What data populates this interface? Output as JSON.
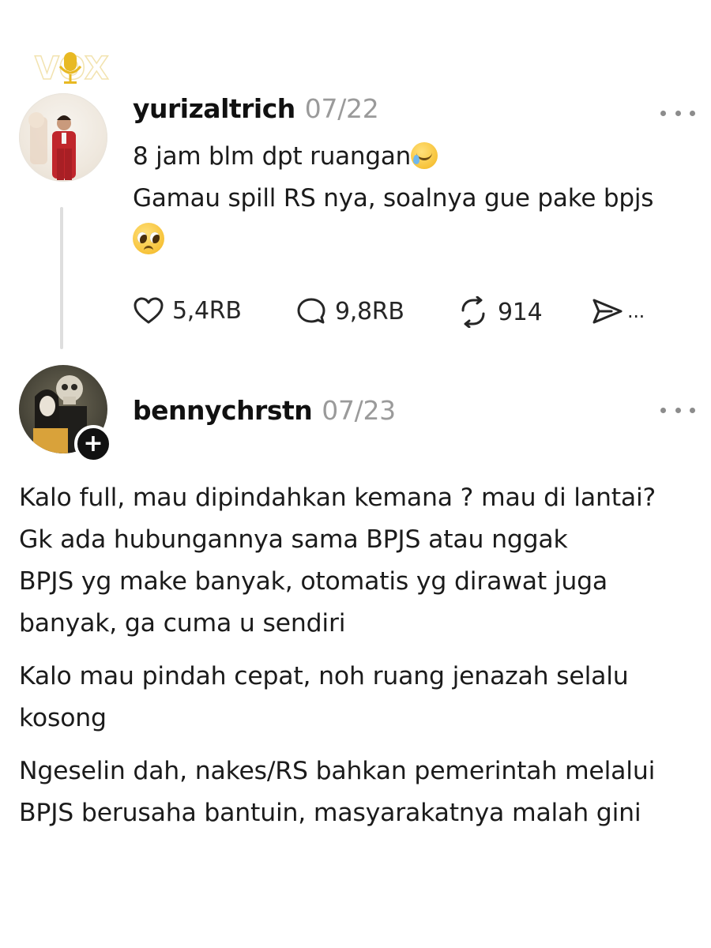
{
  "watermark": {
    "text": "VOX",
    "icon": "microphone-icon"
  },
  "thread": {
    "post": {
      "author": "yurizaltrich",
      "date": "07/22",
      "text_line1": "8 jam blm dpt ruangan",
      "text_line1_emoji": "smiling-face-with-tear",
      "text_line2": "Gamau spill RS nya, soalnya gue pake bpjs",
      "text_line3_emoji": "pleading-face",
      "likes": "5,4RB",
      "replies": "9,8RB",
      "reposts": "914",
      "share_more": "..."
    },
    "reply": {
      "author": "bennychrstn",
      "date": "07/23",
      "follow_label": "+",
      "paragraphs": [
        "Kalo full, mau dipindahkan kemana ? mau di lantai?\nGk ada hubungannya sama BPJS atau nggak\nBPJS yg make banyak, otomatis yg dirawat juga banyak, ga cuma u sendiri",
        "Kalo mau pindah cepat, noh ruang jenazah selalu kosong",
        "Ngeselin dah, nakes/RS bahkan pemerintah melalui BPJS berusaha bantuin, masyarakatnya malah gini"
      ]
    }
  },
  "colors": {
    "text": "#1b1b1b",
    "muted": "#9a9a9a",
    "watermark": "#e8b923",
    "thread_line": "#dedede"
  }
}
